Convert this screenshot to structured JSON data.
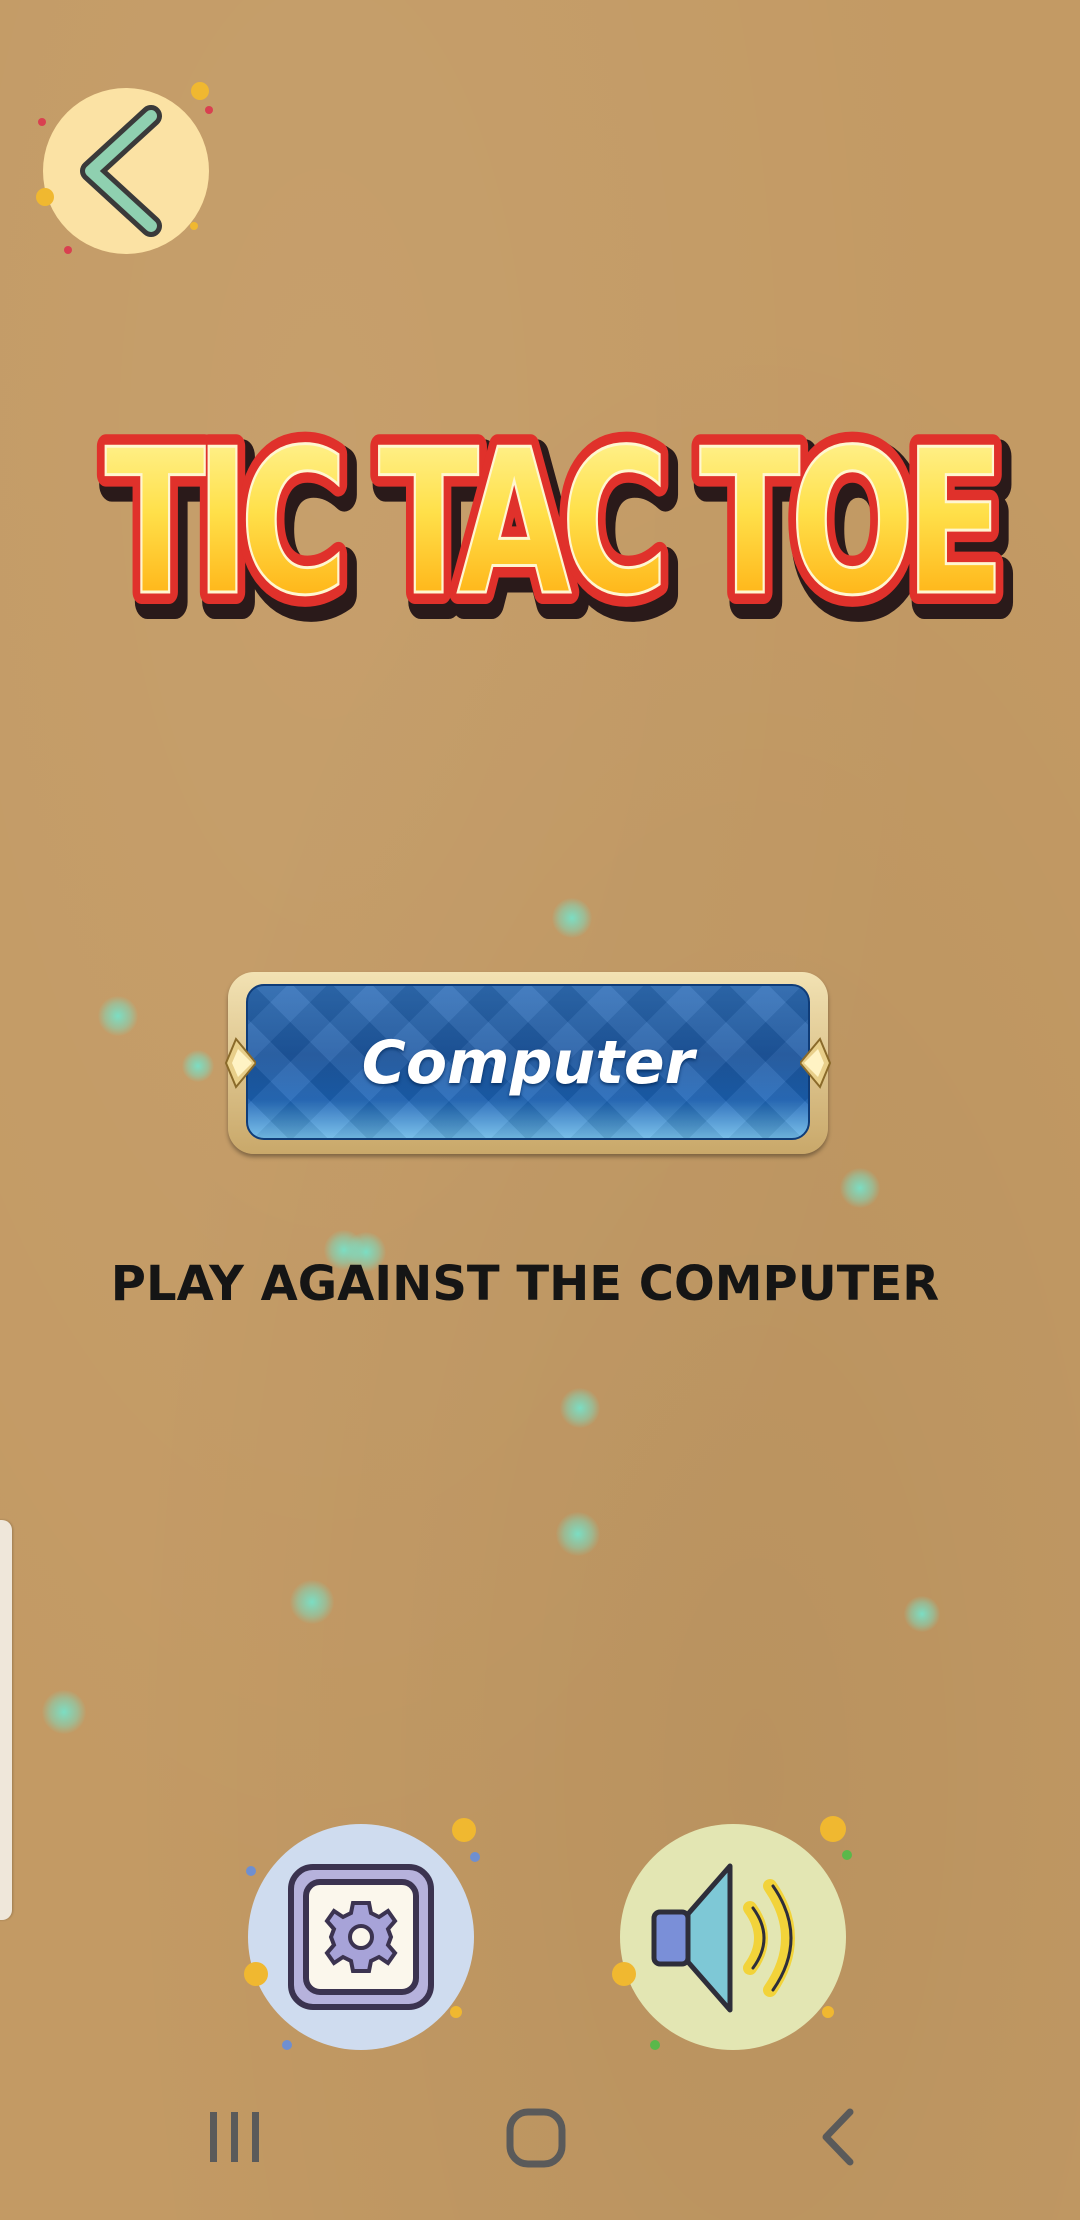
{
  "app": {
    "title": "TIC TAC TOE"
  },
  "back_button": {
    "icon": "chevron-left-icon"
  },
  "main": {
    "mode_button_label": "Computer",
    "mode_description": "PLAY AGAINST THE COMPUTER"
  },
  "bottom_controls": {
    "settings_icon": "gear-icon",
    "sound_icon": "speaker-icon"
  },
  "system_nav": {
    "recents_icon": "recents-icon",
    "home_icon": "home-icon",
    "back_icon": "back-icon"
  },
  "colors": {
    "background": "#c39a64",
    "title_fill_top": "#fff07a",
    "title_fill_bottom": "#ffb000",
    "title_outline": "#e0312b",
    "button_blue": "#1f5aa4"
  }
}
